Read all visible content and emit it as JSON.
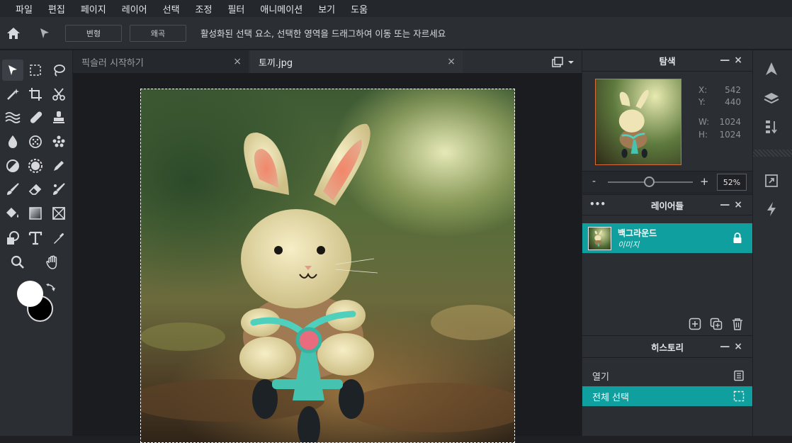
{
  "menu": [
    "파일",
    "편집",
    "페이지",
    "레이어",
    "선택",
    "조정",
    "필터",
    "애니메이션",
    "보기",
    "도움"
  ],
  "options": {
    "transform_label": "변형",
    "warp_label": "왜곡",
    "hint": "활성화된 선택 요소, 선택한 영역을 드래그하여 이동 또는 자르세요"
  },
  "tabs": [
    {
      "label": "픽슬러 시작하기",
      "close": "×"
    },
    {
      "label": "토끼.jpg",
      "close": "×"
    }
  ],
  "navigator": {
    "title": "탐색",
    "x_label": "X:",
    "x_value": "542",
    "y_label": "Y:",
    "y_value": "440",
    "w_label": "W:",
    "w_value": "1024",
    "h_label": "H:",
    "h_value": "1024",
    "zoom_minus": "-",
    "zoom_plus": "+",
    "zoom_value": "52%",
    "zoom_fraction": 0.52
  },
  "layers": {
    "title": "레이어들",
    "more": "•••",
    "items": [
      {
        "name": "백그라운드",
        "type": "이미지",
        "locked": true
      }
    ]
  },
  "history": {
    "title": "히스토리",
    "items": [
      {
        "label": "열기",
        "icon": "document-icon",
        "active": false
      },
      {
        "label": "전체 선택",
        "icon": "selection-icon",
        "active": true
      }
    ]
  },
  "panel_controls": {
    "minimize": "—",
    "close": "×"
  },
  "colors": {
    "accent": "#0e9f9e",
    "foreground": "#ffffff",
    "background": "#000000"
  }
}
